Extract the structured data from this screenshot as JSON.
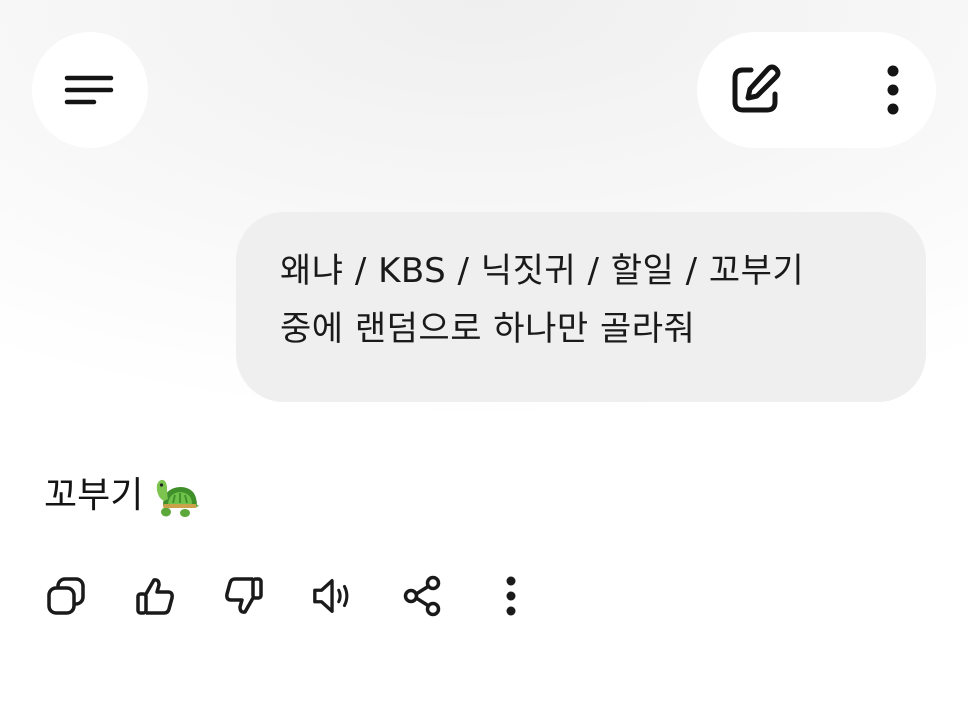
{
  "header": {
    "menu_icon": "hamburger-menu-icon",
    "new_chat_icon": "edit-pen-icon",
    "more_icon": "vertical-dots-icon"
  },
  "conversation": {
    "user_message": {
      "line1": "왜냐 / KBS / 닉짓귀 / 할일 / 꼬부기",
      "line2": "중에 랜덤으로 하나만 골라줘"
    },
    "assistant_message": {
      "text": "꼬부기",
      "emoji_icon": "turtle-emoji-icon"
    }
  },
  "response_toolbar": {
    "icons": [
      "copy-icon",
      "thumbs-up-icon",
      "thumbs-down-icon",
      "speaker-icon",
      "share-icon",
      "more-vertical-icon"
    ]
  },
  "colors": {
    "bubble": "#efefef",
    "text": "#141414",
    "icon": "#1a1a1a"
  }
}
